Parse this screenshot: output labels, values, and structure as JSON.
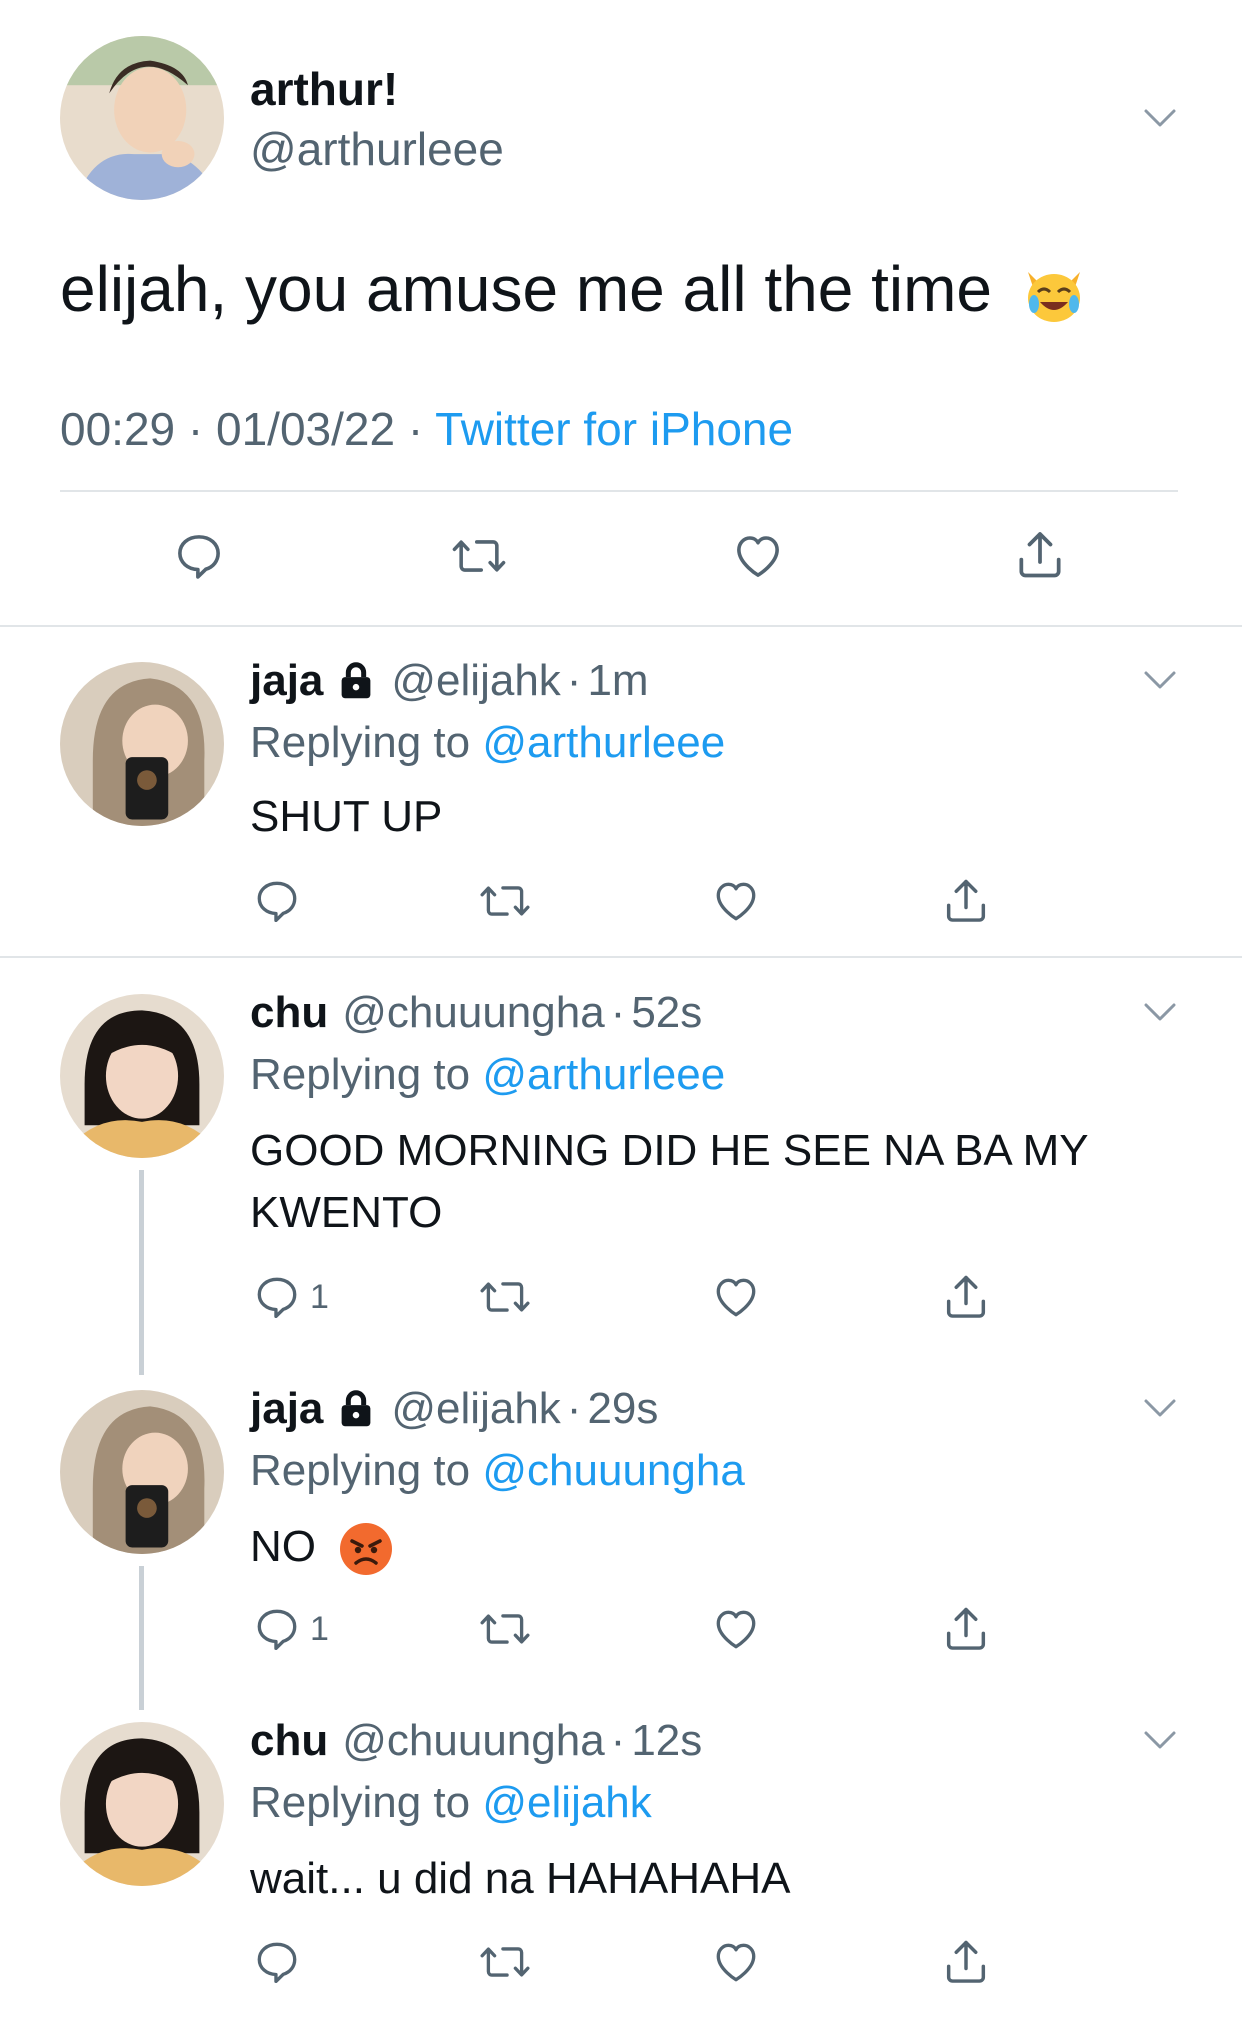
{
  "main_tweet": {
    "author_name": "arthur!",
    "author_handle": "@arthurleee",
    "text": "elijah, you amuse me all the time",
    "emoji": "crying-laughing-cat",
    "time": "00:29",
    "date": "01/03/22",
    "dot": "·",
    "source": "Twitter for iPhone"
  },
  "replies": [
    {
      "name": "jaja",
      "locked": true,
      "handle": "@elijahk",
      "time": "1m",
      "replying_prefix": "Replying to",
      "replying_to": "@arthurleee",
      "text": "SHUT UP",
      "reply_count": ""
    },
    {
      "name": "chu",
      "locked": false,
      "handle": "@chuuungha",
      "time": "52s",
      "replying_prefix": "Replying to",
      "replying_to": "@arthurleee",
      "text": "GOOD MORNING DID HE SEE NA BA MY KWENTO",
      "reply_count": "1"
    },
    {
      "name": "jaja",
      "locked": true,
      "handle": "@elijahk",
      "time": "29s",
      "replying_prefix": "Replying to",
      "replying_to": "@chuuungha",
      "text": "NO",
      "emoji": "angry-face",
      "reply_count": "1"
    },
    {
      "name": "chu",
      "locked": false,
      "handle": "@chuuungha",
      "time": "12s",
      "replying_prefix": "Replying to",
      "replying_to": "@elijahk",
      "text": "wait... u did na HAHAHAHA",
      "reply_count": ""
    }
  ],
  "icons": {
    "reply": "speech-bubble-icon",
    "retweet": "retweet-icon",
    "like": "heart-icon",
    "share": "share-icon",
    "more": "chevron-down-icon",
    "lock": "lock-icon"
  },
  "colors": {
    "link_blue": "#1d9bf0",
    "secondary_gray": "#536471",
    "divider": "#e1e5e8",
    "thread_line": "#c9d0d6"
  }
}
